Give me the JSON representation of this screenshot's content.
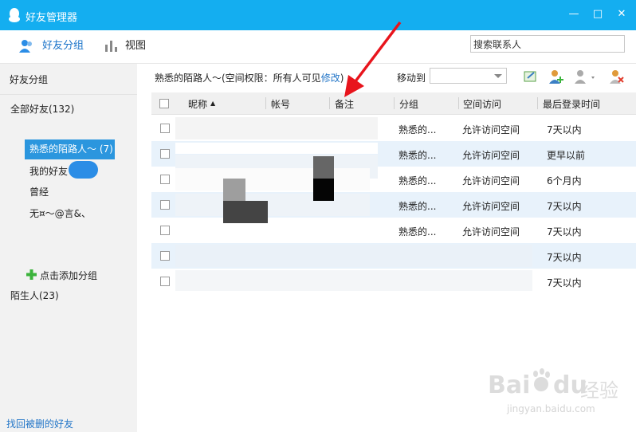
{
  "window": {
    "title": "好友管理器",
    "minimize": "—",
    "maximize": "□",
    "close": "✕"
  },
  "toolbar": {
    "friend_groups": "好友分组",
    "view": "视图",
    "search_placeholder": "搜索联系人"
  },
  "sidebar": {
    "header": "好友分组",
    "all_friends": "全部好友(132)",
    "groups": [
      "熟悉的陌路人～ (7)",
      "我的好友",
      "曾经",
      "无¤～@言&、"
    ],
    "add_group": "点击添加分组",
    "strangers": "陌生人(23)",
    "recover": "找回被删的好友"
  },
  "main": {
    "desc_prefix": "熟悉的陌路人～(空间权限：所有人可见",
    "desc_link": "修改",
    "desc_suffix": ")",
    "move_to": "移动到",
    "columns": {
      "nickname": "昵称",
      "account": "帐号",
      "note": "备注",
      "group": "分组",
      "space": "空间访问",
      "last_login": "最后登录时间"
    },
    "rows": [
      {
        "group": "熟悉的...",
        "space": "允许访问空间",
        "last_login": "7天以内"
      },
      {
        "group": "熟悉的...",
        "space": "允许访问空间",
        "last_login": "更早以前"
      },
      {
        "group": "熟悉的...",
        "space": "允许访问空间",
        "last_login": "6个月内"
      },
      {
        "group": "熟悉的...",
        "space": "允许访问空间",
        "last_login": "7天以内"
      },
      {
        "group": "熟悉的...",
        "space": "允许访问空间",
        "last_login": "7天以内"
      },
      {
        "group": "",
        "space": "",
        "last_login": "7天以内"
      },
      {
        "group": "",
        "space": "",
        "last_login": "7天以内"
      }
    ]
  },
  "watermark": {
    "brand": "Bai",
    "brand2": "du",
    "cn": "经验",
    "url": "jingyan.baidu.com"
  },
  "colors": {
    "titlebar": "#14aef0",
    "selected": "#2b96de",
    "row_alt": "#e8f2fb",
    "link": "#2577c8",
    "annotation_arrow": "#e8141c"
  }
}
